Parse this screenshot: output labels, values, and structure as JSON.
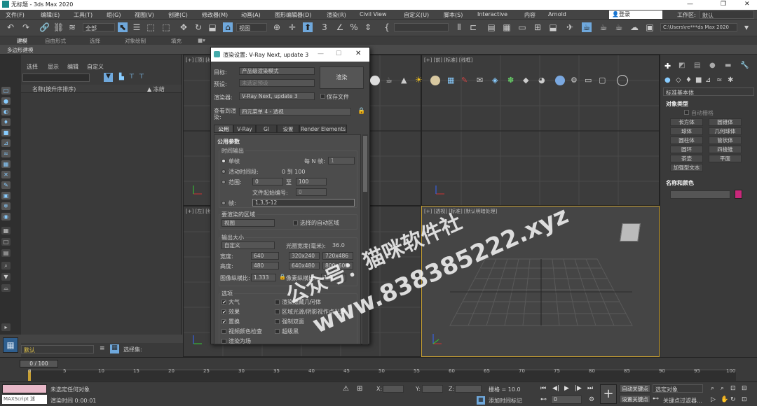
{
  "window": {
    "title": "无标题 - 3ds Max 2020"
  },
  "menu": [
    "文件(F)",
    "编辑(E)",
    "工具(T)",
    "组(G)",
    "视图(V)",
    "创建(C)",
    "修改器(M)",
    "动画(A)",
    "图形编辑器(D)",
    "渲染(R)",
    "Civil View",
    "自定义(U)",
    "脚本(S)",
    "Interactive",
    "内容",
    "Arnold"
  ],
  "account": {
    "login": "登录",
    "workspace_label": "工作区:",
    "workspace_value": "默认"
  },
  "toolbar": {
    "filter_value": "全部",
    "view_value": "视图",
    "path": "C:\\Users\\re***ds Max 2020"
  },
  "ribbon": {
    "tabs": [
      "建模",
      "自由形式",
      "选择",
      "对象绘制",
      "填充"
    ],
    "sub": "多边形建模"
  },
  "explorer": {
    "menus": [
      "选择",
      "显示",
      "编辑",
      "自定义"
    ],
    "col_name": "名称(按升序排序)",
    "col_frozen": "▲ 冻结"
  },
  "viewports": {
    "top": "[+] [顶] [线框]",
    "front": "[+] [前] [标准] [线框]",
    "left": "[+] [左] [线框]",
    "persp": "[+] [透视] [标准] [默认明暗处理]"
  },
  "dialog": {
    "title": "渲染设置: V-Ray Next, update 3",
    "target_label": "目标:",
    "target_value": "产品级渲染模式",
    "preset_label": "预设:",
    "preset_value": "未选定预设",
    "renderer_label": "渲染器:",
    "renderer_value": "V-Ray Next, update 3",
    "save_file": "保存文件",
    "view_label": "查看到渲染:",
    "view_value": "四元菜单 4 - 透视",
    "render_button": "渲染",
    "tabs": [
      "公用",
      "V-Ray",
      "GI",
      "设置",
      "Render Elements"
    ],
    "rollout": "公用参数",
    "time_output": "时间输出",
    "single": "单帧",
    "every_n": "每 N 帧:",
    "every_n_value": "1",
    "active_segment": "活动时间段:",
    "active_range": "0 到 100",
    "range": "范围:",
    "range_from": "0",
    "range_to_label": "至",
    "range_to": "100",
    "file_start": "文件起始编号:",
    "file_start_value": "0",
    "frames": "帧:",
    "frames_value": "1,3,5-12",
    "area_label": "要渲染的区域",
    "area_value": "视图",
    "auto_region": "选择的自动区域",
    "output_size": "输出大小",
    "size_preset": "自定义",
    "aperture_label": "光圈宽度(毫米):",
    "aperture_value": "36.0",
    "width_label": "宽度:",
    "width_value": "640",
    "height_label": "高度:",
    "height_value": "480",
    "presets": [
      "320x240",
      "720x486",
      "640x480",
      "800x600"
    ],
    "aspect_label": "图像纵横比:",
    "aspect_value": "1.333",
    "pixel_aspect_label": "像素纵横比:",
    "pixel_aspect_value": "1.0",
    "options": "选项",
    "opt_left": [
      "大气",
      "效果",
      "置换",
      "视频颜色检查",
      "渲染为场"
    ],
    "opt_right": [
      "渲染隐藏几何体",
      "区域光源/阴影视作点光源",
      "强制双面",
      "超级黑"
    ]
  },
  "command_panel": {
    "dropdown": "标准基本体",
    "rollout_type": "对象类型",
    "auto_grid": "自动栅格",
    "objects": [
      "长方体",
      "圆锥体",
      "球体",
      "几何球体",
      "圆柱体",
      "管状体",
      "圆环",
      "四棱锥",
      "茶壶",
      "平面",
      "加强型文本"
    ],
    "name_color": "名称和颜色",
    "color": "#c8287a"
  },
  "timeline": {
    "frame": "0 / 100",
    "ticks": [
      "0",
      "5",
      "10",
      "15",
      "20",
      "25",
      "30",
      "35",
      "40",
      "45",
      "50",
      "55",
      "60",
      "65",
      "70",
      "75",
      "80",
      "85",
      "90",
      "95",
      "100"
    ]
  },
  "status": {
    "script": "MAXScript 迷",
    "none_selected": "未选定任何对象",
    "render_time": "渲染时间  0:00:01",
    "x": "X:",
    "y": "Y:",
    "z": "Z:",
    "grid": "栅格 = 10.0",
    "add_time_tag": "添加时间标记",
    "auto_key": "自动关键点",
    "set_key": "设置关键点",
    "selected": "选定对象",
    "key_filter": "关键点过滤器...",
    "frame_value": "0"
  },
  "layer": {
    "value": "默认",
    "selection_set": "选择集:"
  },
  "watermark": {
    "line1": "公众号：猫咪软件社",
    "line2": "www.838385222.xyz"
  }
}
